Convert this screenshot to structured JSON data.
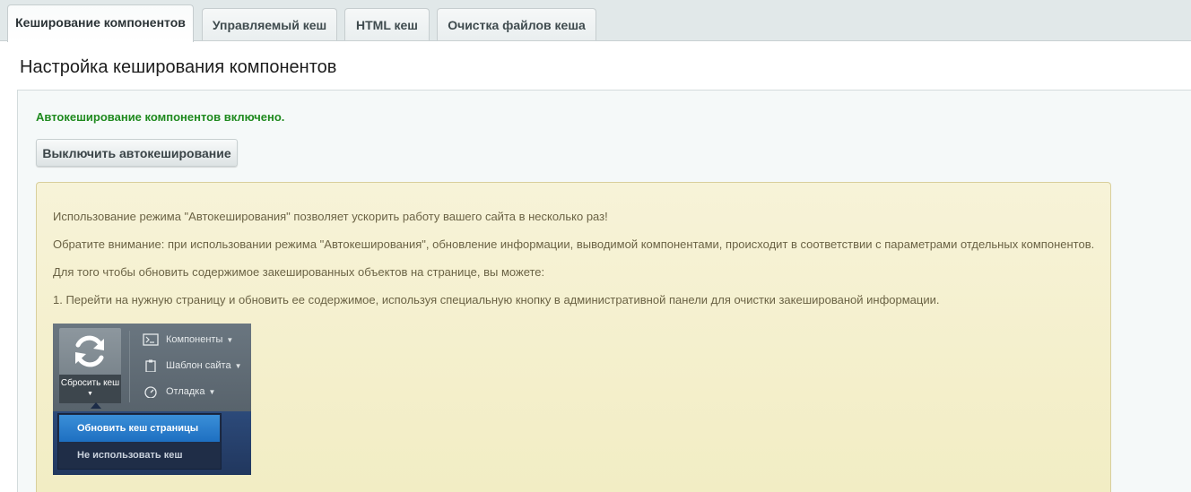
{
  "tabs": [
    {
      "label": "Кеширование компонентов",
      "active": true
    },
    {
      "label": "Управляемый кеш",
      "active": false
    },
    {
      "label": "HTML кеш",
      "active": false
    },
    {
      "label": "Очистка файлов кеша",
      "active": false
    }
  ],
  "page": {
    "title": "Настройка кеширования компонентов",
    "status": "Автокеширование компонентов включено.",
    "status_color": "#1f8a1f",
    "disable_button": "Выключить автокеширование"
  },
  "note": {
    "lines": [
      "Использование режима \"Автокеширования\" позволяет ускорить работу вашего сайта в несколько раз!",
      "Обратите внимание: при использовании режима \"Автокеширования\", обновление информации, выводимой компонентами, происходит в соответствии с параметрами отдельных компонентов.",
      "Для того чтобы обновить содержимое закешированных объектов на странице, вы можете:",
      "1. Перейти на нужную страницу и обновить ее содержимое, используя специальную кнопку в административной панели для очистки закешированой информации."
    ]
  },
  "illustration": {
    "reset_button_label": "Сбросить кеш",
    "menu": [
      {
        "label": "Компоненты",
        "icon": "terminal-icon"
      },
      {
        "label": "Шаблон сайта",
        "icon": "clipboard-icon"
      },
      {
        "label": "Отладка",
        "icon": "gauge-icon"
      }
    ],
    "dropdown": [
      "Обновить кеш страницы",
      "Не использовать кеш"
    ]
  }
}
